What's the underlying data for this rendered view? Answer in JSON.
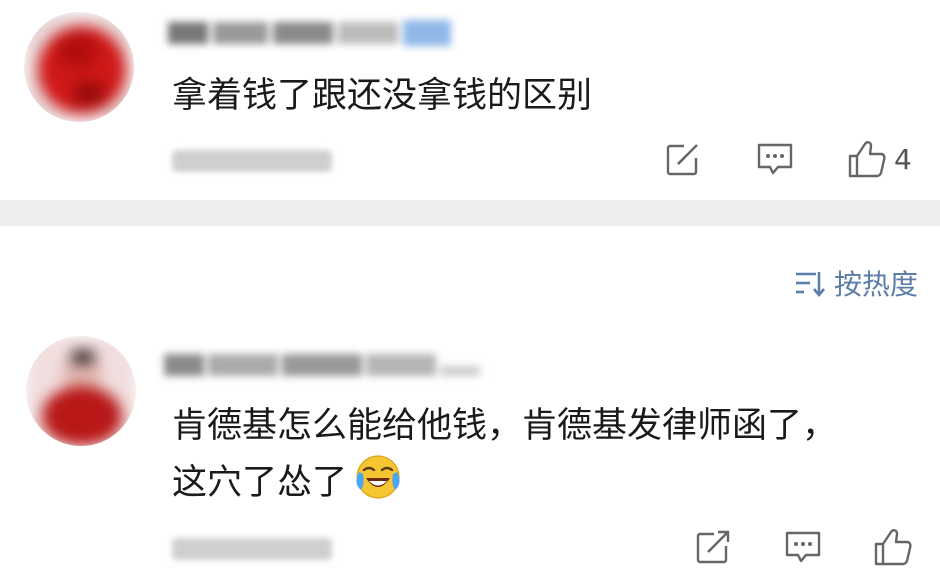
{
  "comments": [
    {
      "text": "拿着钱了跟还没拿钱的区别",
      "like_count": "4"
    },
    {
      "text_line1": "肯德基怎么能给他钱，肯德基发律师函了，",
      "text_line2": "这⽳了怂了"
    }
  ],
  "sort": {
    "label": "按热度"
  },
  "icons": {
    "share": "share-icon",
    "comment": "comment-icon",
    "like": "thumbs-up-icon",
    "sort": "sort-icon",
    "emoji": "crying-laughing-emoji-icon"
  },
  "colors": {
    "divider": "#eeeeee",
    "sort_text": "#5a7ea8",
    "icon_gray": "#666666"
  }
}
